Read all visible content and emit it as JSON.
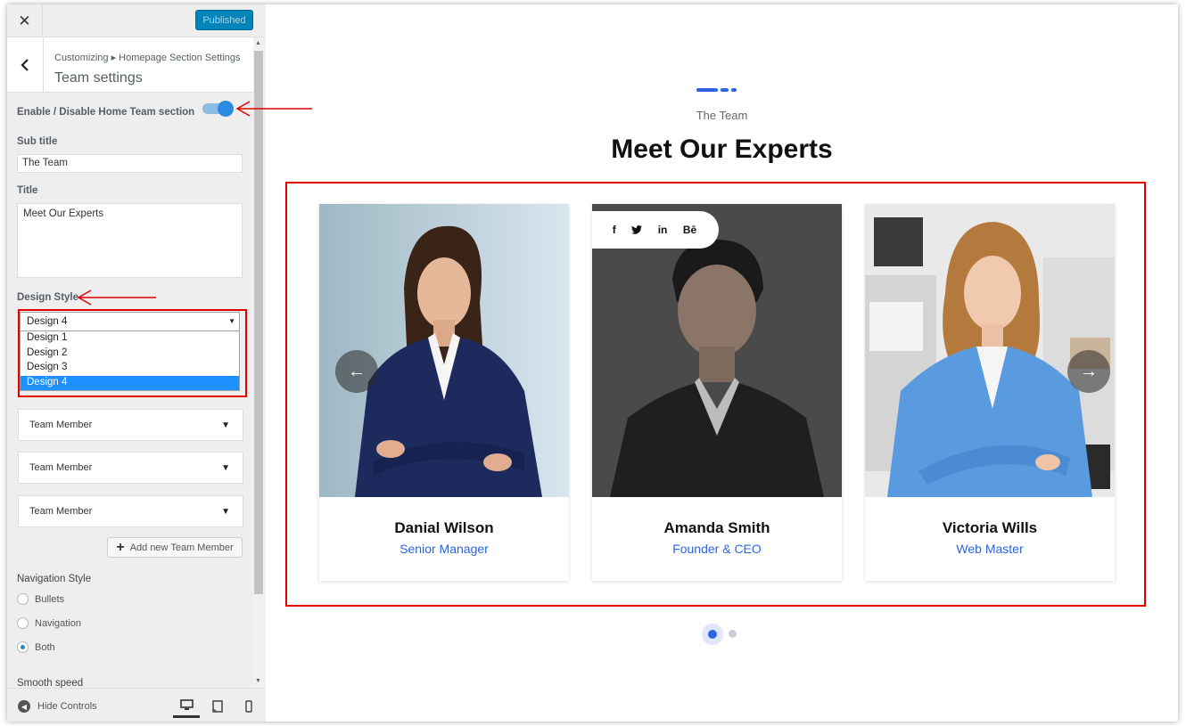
{
  "sidebar": {
    "close_label": "✕",
    "publish_label": "Published",
    "breadcrumb": "Customizing ▸ Homepage Section Settings",
    "section_title": "Team settings",
    "enable_label": "Enable / Disable Home Team section",
    "enable_on": true,
    "subtitle_label": "Sub title",
    "subtitle_value": "The Team",
    "title_label": "Title",
    "title_value": "Meet Our Experts",
    "design_style_label": "Design Style",
    "design_selected": "Design 4",
    "design_options": [
      "Design 1",
      "Design 2",
      "Design 3",
      "Design 4"
    ],
    "members": [
      "Team Member",
      "Team Member",
      "Team Member"
    ],
    "add_member_label": "Add new Team Member",
    "nav_style_label": "Navigation Style",
    "nav_options": [
      "Bullets",
      "Navigation",
      "Both"
    ],
    "nav_selected": "Both",
    "smooth_speed_label": "Smooth speed",
    "hide_controls_label": "Hide Controls"
  },
  "preview": {
    "subtitle": "The Team",
    "title": "Meet Our Experts",
    "social": [
      "f",
      "🐦",
      "in",
      "Bē"
    ],
    "members": [
      {
        "name": "Danial Wilson",
        "role": "Senior Manager"
      },
      {
        "name": "Amanda Smith",
        "role": "Founder & CEO"
      },
      {
        "name": "Victoria Wills",
        "role": "Web Master"
      }
    ],
    "prev_arrow": "←",
    "next_arrow": "→",
    "accent_color": "#2c64e3"
  }
}
